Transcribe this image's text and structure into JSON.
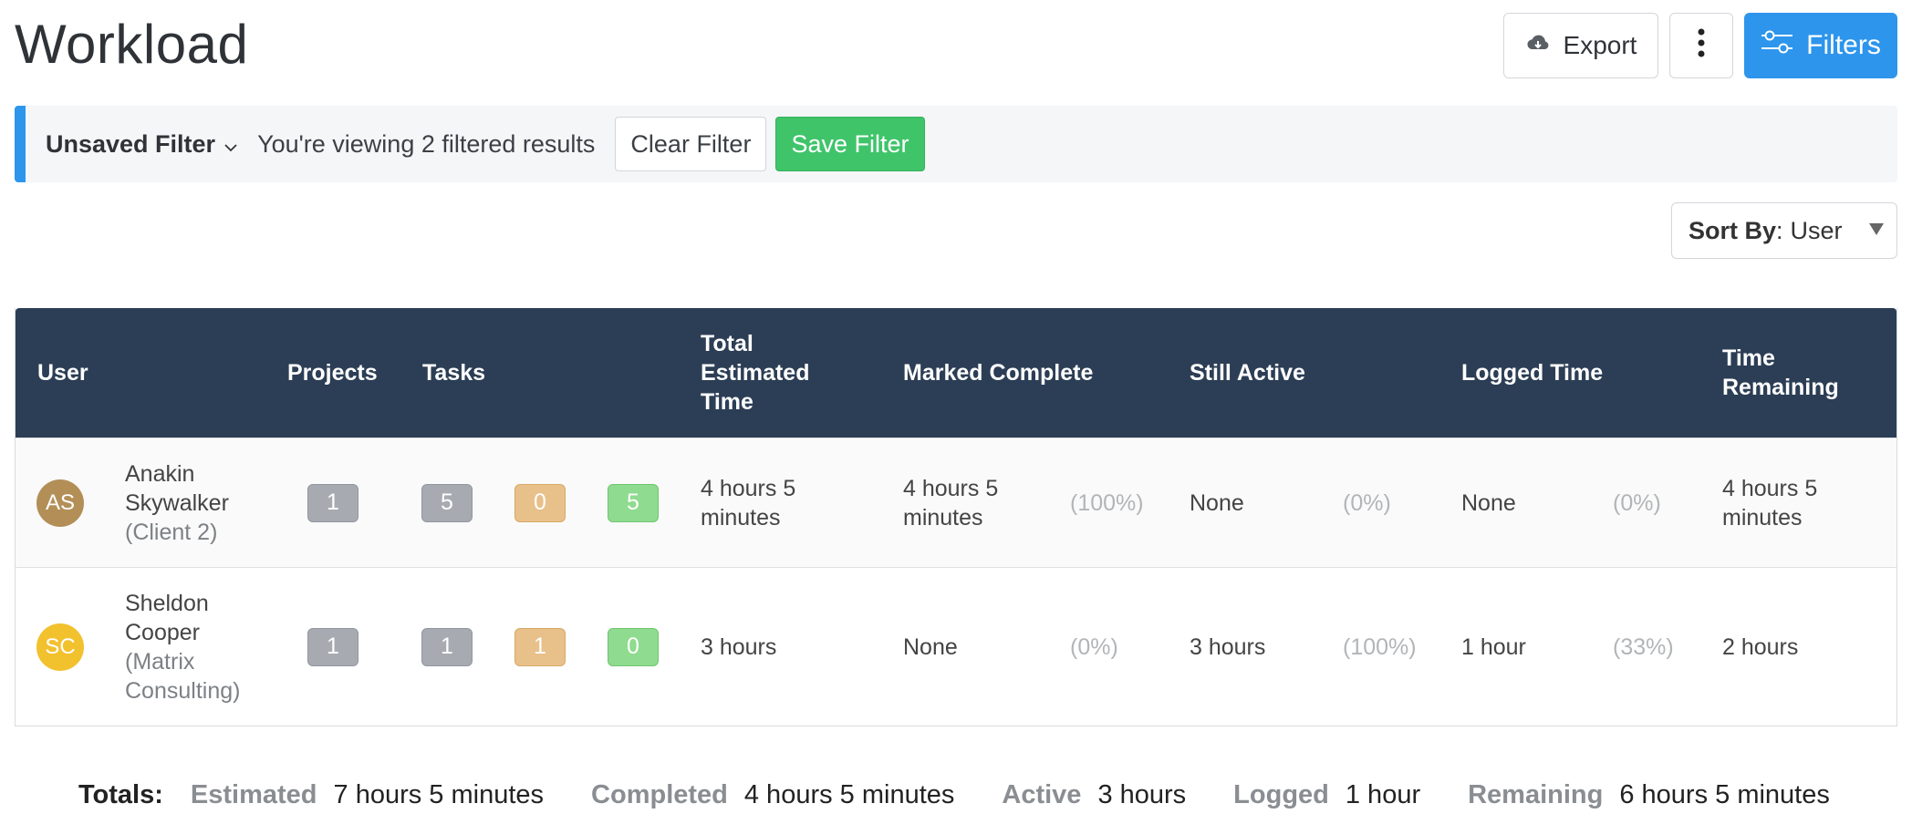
{
  "page": {
    "title": "Workload"
  },
  "toolbar": {
    "export_label": "Export",
    "filters_label": "Filters"
  },
  "filter_bar": {
    "name": "Unsaved Filter",
    "status_text": "You're viewing 2 filtered results",
    "clear_label": "Clear Filter",
    "save_label": "Save Filter"
  },
  "sort": {
    "label": "Sort By",
    "colon": ":",
    "value": "User"
  },
  "table": {
    "headers": {
      "user": "User",
      "projects": "Projects",
      "tasks": "Tasks",
      "total_estimated": "Total Estimated Time",
      "marked_complete": "Marked Complete",
      "still_active": "Still Active",
      "logged_time": "Logged Time",
      "time_remaining": "Time Remaining"
    },
    "rows": [
      {
        "initials": "AS",
        "avatar_color": "#b38f57",
        "name": "Anakin Skywalker",
        "client": "(Client 2)",
        "projects": "1",
        "tasks_total": "5",
        "tasks_open": "0",
        "tasks_done": "5",
        "total_estimated": "4 hours 5 minutes",
        "marked_complete": "4 hours 5 minutes",
        "marked_complete_pct": "(100%)",
        "still_active": "None",
        "still_active_pct": "(0%)",
        "logged_time": "None",
        "logged_time_pct": "(0%)",
        "time_remaining": "4 hours 5 minutes"
      },
      {
        "initials": "SC",
        "avatar_color": "#f2c12e",
        "name": "Sheldon Cooper",
        "client": "(Matrix Consulting)",
        "projects": "1",
        "tasks_total": "1",
        "tasks_open": "1",
        "tasks_done": "0",
        "total_estimated": "3 hours",
        "marked_complete": "None",
        "marked_complete_pct": "(0%)",
        "still_active": "3 hours",
        "still_active_pct": "(100%)",
        "logged_time": "1 hour",
        "logged_time_pct": "(33%)",
        "time_remaining": "2 hours"
      }
    ]
  },
  "totals": {
    "label": "Totals:",
    "estimated_label": "Estimated",
    "estimated": "7 hours 5 minutes",
    "completed_label": "Completed",
    "completed": "4 hours 5 minutes",
    "active_label": "Active",
    "active": "3 hours",
    "logged_label": "Logged",
    "logged": "1 hour",
    "remaining_label": "Remaining",
    "remaining": "6 hours 5 minutes"
  },
  "colors": {
    "accent": "#2d95ec",
    "save": "#3fc46a",
    "header_bg": "#2c3e55"
  }
}
